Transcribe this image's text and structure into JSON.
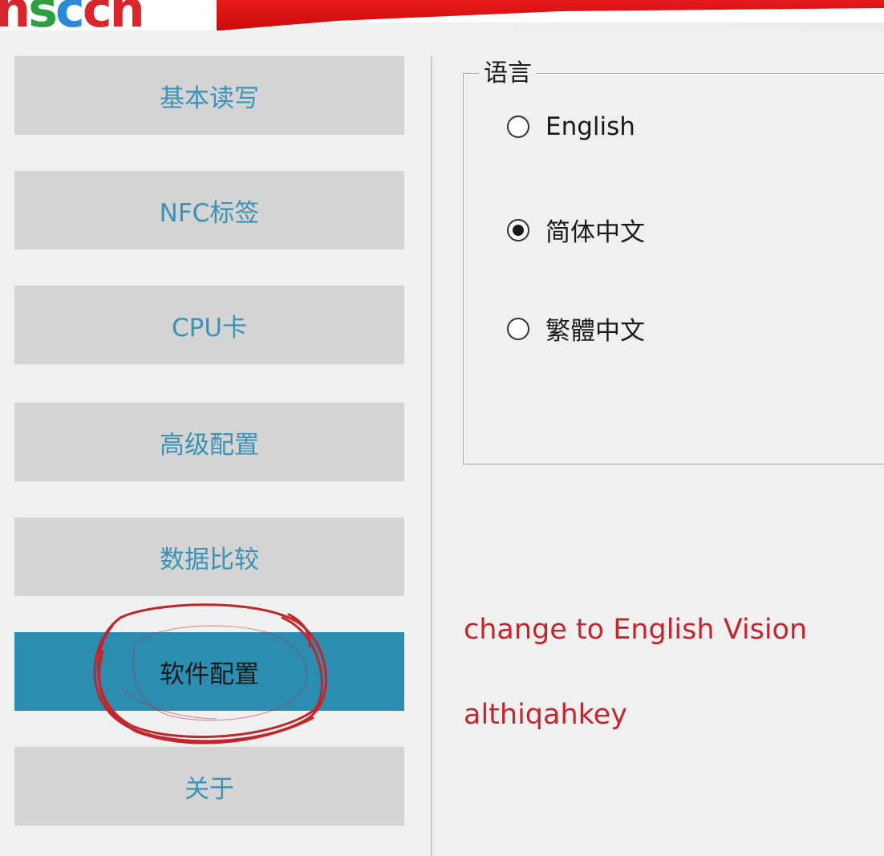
{
  "header": {
    "logo_text": "nsccn",
    "colors": {
      "banner_red": "#d40f10",
      "logo_red": "#d8262a",
      "logo_green": "#2f9e3e",
      "logo_blue": "#2a8ad6"
    }
  },
  "sidebar": {
    "items": [
      {
        "label": "基本读写",
        "active": false
      },
      {
        "label": "NFC标签",
        "active": false
      },
      {
        "label": "CPU卡",
        "active": false
      },
      {
        "label": "高级配置",
        "active": false
      },
      {
        "label": "数据比较",
        "active": false
      },
      {
        "label": "软件配置",
        "active": true
      },
      {
        "label": "关于",
        "active": false
      }
    ],
    "colors": {
      "button_bg": "#d4d4d4",
      "button_text": "#3a93b5",
      "active_bg": "#2b8eb0",
      "active_text": "#1a1a1a"
    }
  },
  "language_group": {
    "title": "语言",
    "options": [
      {
        "label": "English",
        "selected": false
      },
      {
        "label": "简体中文",
        "selected": true
      },
      {
        "label": "繁體中文",
        "selected": false
      }
    ]
  },
  "annotations": {
    "line1": "change to English Vision",
    "line2": "althiqahkey",
    "color": "#c3272d"
  }
}
